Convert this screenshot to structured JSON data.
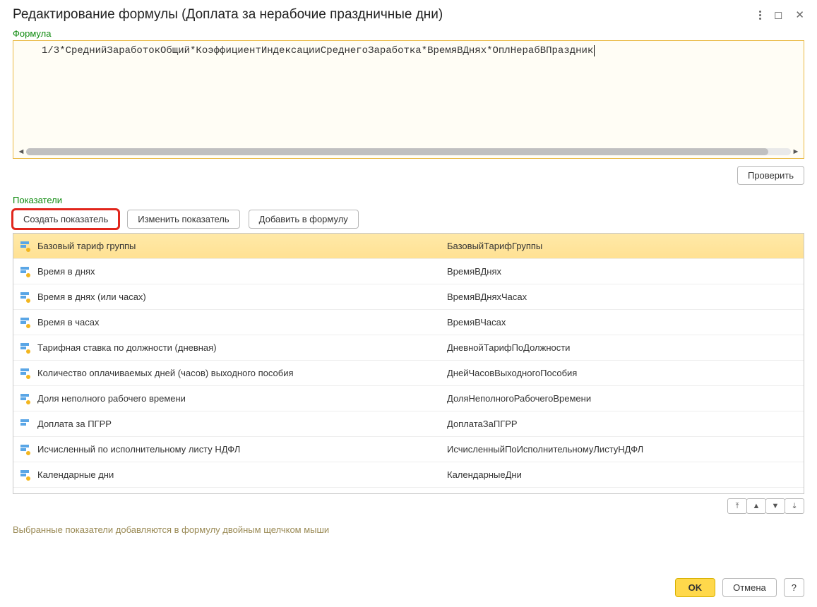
{
  "window": {
    "title": "Редактирование формулы (Доплата за нерабочие праздничные дни)"
  },
  "formula": {
    "label": "Формула",
    "expression": "1/3*СреднийЗаработокОбщий*КоэффициентИндексацииСреднегоЗаработка*ВремяВДнях*ОплНерабВПраздник"
  },
  "buttons": {
    "verify": "Проверить",
    "create_indicator": "Создать показатель",
    "edit_indicator": "Изменить показатель",
    "add_to_formula": "Добавить в формулу",
    "ok": "OK",
    "cancel": "Отмена",
    "help": "?"
  },
  "indicators": {
    "label": "Показатели",
    "rows": [
      {
        "name": "Базовый тариф группы",
        "code": "БазовыйТарифГруппы",
        "selected": true,
        "dot": true
      },
      {
        "name": "Время в днях",
        "code": "ВремяВДнях",
        "selected": false,
        "dot": true
      },
      {
        "name": "Время в днях (или часах)",
        "code": "ВремяВДняхЧасах",
        "selected": false,
        "dot": true
      },
      {
        "name": "Время в часах",
        "code": "ВремяВЧасах",
        "selected": false,
        "dot": true
      },
      {
        "name": "Тарифная ставка по должности (дневная)",
        "code": "ДневнойТарифПоДолжности",
        "selected": false,
        "dot": true
      },
      {
        "name": "Количество оплачиваемых дней (часов) выходного пособия",
        "code": "ДнейЧасовВыходногоПособия",
        "selected": false,
        "dot": true
      },
      {
        "name": "Доля неполного рабочего времени",
        "code": "ДоляНеполногоРабочегоВремени",
        "selected": false,
        "dot": true
      },
      {
        "name": "Доплата за ПГРР",
        "code": "ДоплатаЗаПГРР",
        "selected": false,
        "dot": false
      },
      {
        "name": "Исчисленный по исполнительному листу НДФЛ",
        "code": "ИсчисленныйПоИсполнительномуЛистуНДФЛ",
        "selected": false,
        "dot": true
      },
      {
        "name": "Календарные дни",
        "code": "КалендарныеДни",
        "selected": false,
        "dot": true
      }
    ]
  },
  "hint": "Выбранные показатели добавляются в формулу двойным щелчком мыши"
}
